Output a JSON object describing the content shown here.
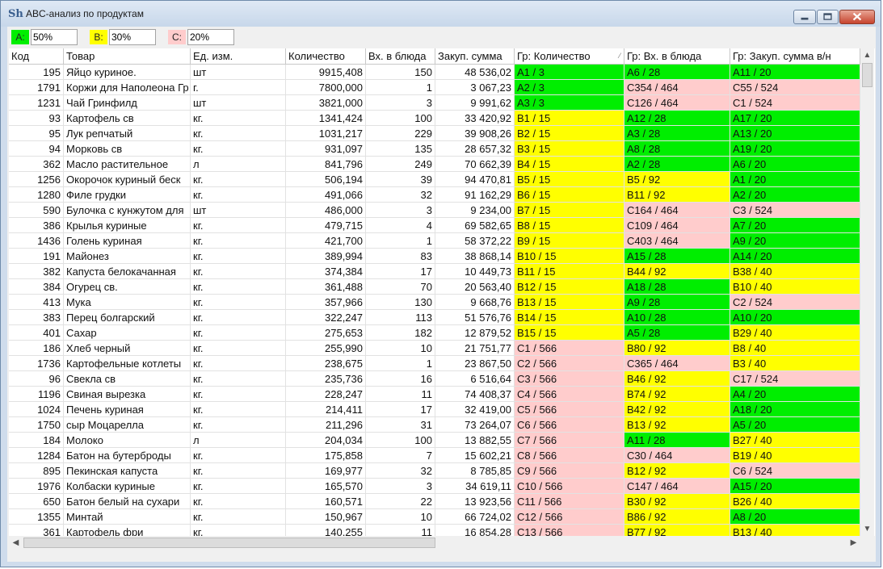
{
  "window": {
    "title": "ABC-анализ по продуктам",
    "app_icon": "Sh"
  },
  "colors": {
    "A": "#00ee00",
    "B": "#ffff00",
    "C": "#ffcccc"
  },
  "thresholds": [
    {
      "label": "A:",
      "value": "50%",
      "class": "A"
    },
    {
      "label": "B:",
      "value": "30%",
      "class": "B"
    },
    {
      "label": "C:",
      "value": "20%",
      "class": "C"
    }
  ],
  "columns": [
    "Код",
    "Товар",
    "Ед. изм.",
    "Количество",
    "Вх. в блюда",
    "Закуп. сумма",
    "Гр: Количество",
    "Гр: Вх. в блюда",
    "Гр: Закуп. сумма в/н"
  ],
  "sorted_column": "Гр: Количество",
  "rows": [
    [
      "195",
      "Яйцо куриное.",
      "шт",
      "9915,408",
      "150",
      "48 536,02",
      "A1 / 3",
      "A6 / 28",
      "A11 / 20"
    ],
    [
      "1791",
      "Коржи для Наполеона Гр",
      "г.",
      "7800,000",
      "1",
      "3 067,23",
      "A2 / 3",
      "C354 / 464",
      "C55 / 524"
    ],
    [
      "1231",
      "Чай Гринфилд",
      "шт",
      "3821,000",
      "3",
      "9 991,62",
      "A3 / 3",
      "C126 / 464",
      "C1 / 524"
    ],
    [
      "93",
      "Картофель св",
      "кг.",
      "1341,424",
      "100",
      "33 420,92",
      "B1 / 15",
      "A12 / 28",
      "A17 / 20"
    ],
    [
      "95",
      "Лук репчатый",
      "кг.",
      "1031,217",
      "229",
      "39 908,26",
      "B2 / 15",
      "A3 / 28",
      "A13 / 20"
    ],
    [
      "94",
      "Морковь св",
      "кг.",
      "931,097",
      "135",
      "28 657,32",
      "B3 / 15",
      "A8 / 28",
      "A19 / 20"
    ],
    [
      "362",
      "Масло растительное",
      "л",
      "841,796",
      "249",
      "70 662,39",
      "B4 / 15",
      "A2 / 28",
      "A6 / 20"
    ],
    [
      "1256",
      "Окорочок куриный беск",
      "кг.",
      "506,194",
      "39",
      "94 470,81",
      "B5 / 15",
      "B5 / 92",
      "A1 / 20"
    ],
    [
      "1280",
      "Филе грудки",
      "кг.",
      "491,066",
      "32",
      "91 162,29",
      "B6 / 15",
      "B11 / 92",
      "A2 / 20"
    ],
    [
      "590",
      "Булочка с кунжутом для",
      "шт",
      "486,000",
      "3",
      "9 234,00",
      "B7 / 15",
      "C164 / 464",
      "C3 / 524"
    ],
    [
      "386",
      "Крылья куриные",
      "кг.",
      "479,715",
      "4",
      "69 582,65",
      "B8 / 15",
      "C109 / 464",
      "A7 / 20"
    ],
    [
      "1436",
      "Голень куриная",
      "кг.",
      "421,700",
      "1",
      "58 372,22",
      "B9 / 15",
      "C403 / 464",
      "A9 / 20"
    ],
    [
      "191",
      "Майонез",
      "кг.",
      "389,994",
      "83",
      "38 868,14",
      "B10 / 15",
      "A15 / 28",
      "A14 / 20"
    ],
    [
      "382",
      "Капуста белокачанная",
      "кг.",
      "374,384",
      "17",
      "10 449,73",
      "B11 / 15",
      "B44 / 92",
      "B38 / 40"
    ],
    [
      "384",
      "Огурец св.",
      "кг.",
      "361,488",
      "70",
      "20 563,40",
      "B12 / 15",
      "A18 / 28",
      "B10 / 40"
    ],
    [
      "413",
      "Мука",
      "кг.",
      "357,966",
      "130",
      "9 668,76",
      "B13 / 15",
      "A9 / 28",
      "C2 / 524"
    ],
    [
      "383",
      "Перец болгарский",
      "кг.",
      "322,247",
      "113",
      "51 576,76",
      "B14 / 15",
      "A10 / 28",
      "A10 / 20"
    ],
    [
      "401",
      "Сахар",
      "кг.",
      "275,653",
      "182",
      "12 879,52",
      "B15 / 15",
      "A5 / 28",
      "B29 / 40"
    ],
    [
      "186",
      "Хлеб черный",
      "кг.",
      "255,990",
      "10",
      "21 751,77",
      "C1 / 566",
      "B80 / 92",
      "B8 / 40"
    ],
    [
      "1736",
      "Картофельные котлеты",
      "кг.",
      "238,675",
      "1",
      "23 867,50",
      "C2 / 566",
      "C365 / 464",
      "B3 / 40"
    ],
    [
      "96",
      "Свекла св",
      "кг.",
      "235,736",
      "16",
      "6 516,64",
      "C3 / 566",
      "B46 / 92",
      "C17 / 524"
    ],
    [
      "1196",
      "Свиная вырезка",
      "кг.",
      "228,247",
      "11",
      "74 408,37",
      "C4 / 566",
      "B74 / 92",
      "A4 / 20"
    ],
    [
      "1024",
      "Печень куриная",
      "кг.",
      "214,411",
      "17",
      "32 419,00",
      "C5 / 566",
      "B42 / 92",
      "A18 / 20"
    ],
    [
      "1750",
      "сыр Моцарелла",
      "кг.",
      "211,296",
      "31",
      "73 264,07",
      "C6 / 566",
      "B13 / 92",
      "A5 / 20"
    ],
    [
      "184",
      "Молоко",
      "л",
      "204,034",
      "100",
      "13 882,55",
      "C7 / 566",
      "A11 / 28",
      "B27 / 40"
    ],
    [
      "1284",
      "Батон на бутерброды",
      "кг.",
      "175,858",
      "7",
      "15 602,21",
      "C8 / 566",
      "C30 / 464",
      "B19 / 40"
    ],
    [
      "895",
      "Пекинская капуста",
      "кг.",
      "169,977",
      "32",
      "8 785,85",
      "C9 / 566",
      "B12 / 92",
      "C6 / 524"
    ],
    [
      "1976",
      "Колбаски куриные",
      "кг.",
      "165,570",
      "3",
      "34 619,11",
      "C10 / 566",
      "C147 / 464",
      "A15 / 20"
    ],
    [
      "650",
      "Батон белый на сухари",
      "кг.",
      "160,571",
      "22",
      "13 923,56",
      "C11 / 566",
      "B30 / 92",
      "B26 / 40"
    ],
    [
      "1355",
      "Минтай",
      "кг.",
      "150,967",
      "10",
      "66 724,02",
      "C12 / 566",
      "B86 / 92",
      "A8 / 20"
    ],
    [
      "361",
      "Картофель фри",
      "кг.",
      "140,255",
      "11",
      "16 854,28",
      "C13 / 566",
      "B77 / 92",
      "B13 / 40"
    ]
  ]
}
